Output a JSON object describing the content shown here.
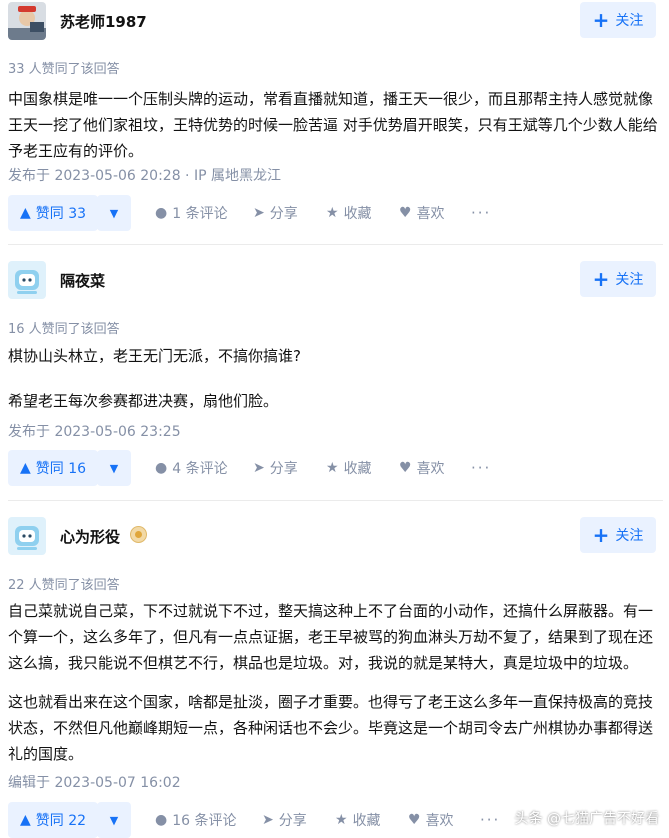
{
  "answers": [
    {
      "author": "苏老师1987",
      "follow_label": "关注",
      "voters": "33 人赞同了该回答",
      "paragraphs": [
        "中国象棋是唯一一个压制头牌的运动，常看直播就知道，播王天一很少，而且那帮主持人感觉就像王天一挖了他们家祖坟，王特优势的时候一脸苦逼 对手优势眉开眼笑，只有王斌等几个少数人能给予老王应有的评价。"
      ],
      "meta": "发布于 2023-05-06 20:28 · IP 属地黑龙江",
      "upvote_label": "赞同 33",
      "comments_label": "1 条评论",
      "share_label": "分享",
      "collect_label": "收藏",
      "like_label": "喜欢",
      "more_label": "···"
    },
    {
      "author": "隔夜菜",
      "follow_label": "关注",
      "voters": "16 人赞同了该回答",
      "paragraphs": [
        "棋协山头林立，老王无门无派，不搞你搞谁?",
        "希望老王每次参赛都进决赛，扇他们脸。"
      ],
      "meta": "发布于 2023-05-06 23:25",
      "upvote_label": "赞同 16",
      "comments_label": "4 条评论",
      "share_label": "分享",
      "collect_label": "收藏",
      "like_label": "喜欢",
      "more_label": "···"
    },
    {
      "author": "心为形役",
      "follow_label": "关注",
      "voters": "22 人赞同了该回答",
      "paragraphs": [
        "自己菜就说自己菜，下不过就说下不过，整天搞这种上不了台面的小动作，还搞什么屏蔽器。有一个算一个，这么多年了，但凡有一点点证据，老王早被骂的狗血淋头万劫不复了，结果到了现在还这么搞，我只能说不但棋艺不行，棋品也是垃圾。对，我说的就是某特大，真是垃圾中的垃圾。",
        "这也就看出来在这个国家，啥都是扯淡，圈子才重要。也得亏了老王这么多年一直保持极高的竞技状态，不然但凡他巅峰期短一点，各种闲话也不会少。毕竟这是一个胡司令去广州棋协办事都得送礼的国度。"
      ],
      "meta": "编辑于 2023-05-07 16:02",
      "upvote_label": "赞同 22",
      "comments_label": "16 条评论",
      "share_label": "分享",
      "collect_label": "收藏",
      "like_label": "喜欢",
      "more_label": "···"
    }
  ],
  "watermark": "头条 @七猫广告不好看",
  "colors": {
    "accent": "#1772f6",
    "accent_bg": "#eaf2ff",
    "muted": "#8590a6",
    "text": "#121212"
  },
  "icons": {
    "comment": "comment-icon",
    "share": "share-icon",
    "collect": "star-icon",
    "like": "heart-icon",
    "upvote": "triangle-up-icon",
    "downvote": "triangle-down-icon",
    "follow": "plus-icon"
  }
}
